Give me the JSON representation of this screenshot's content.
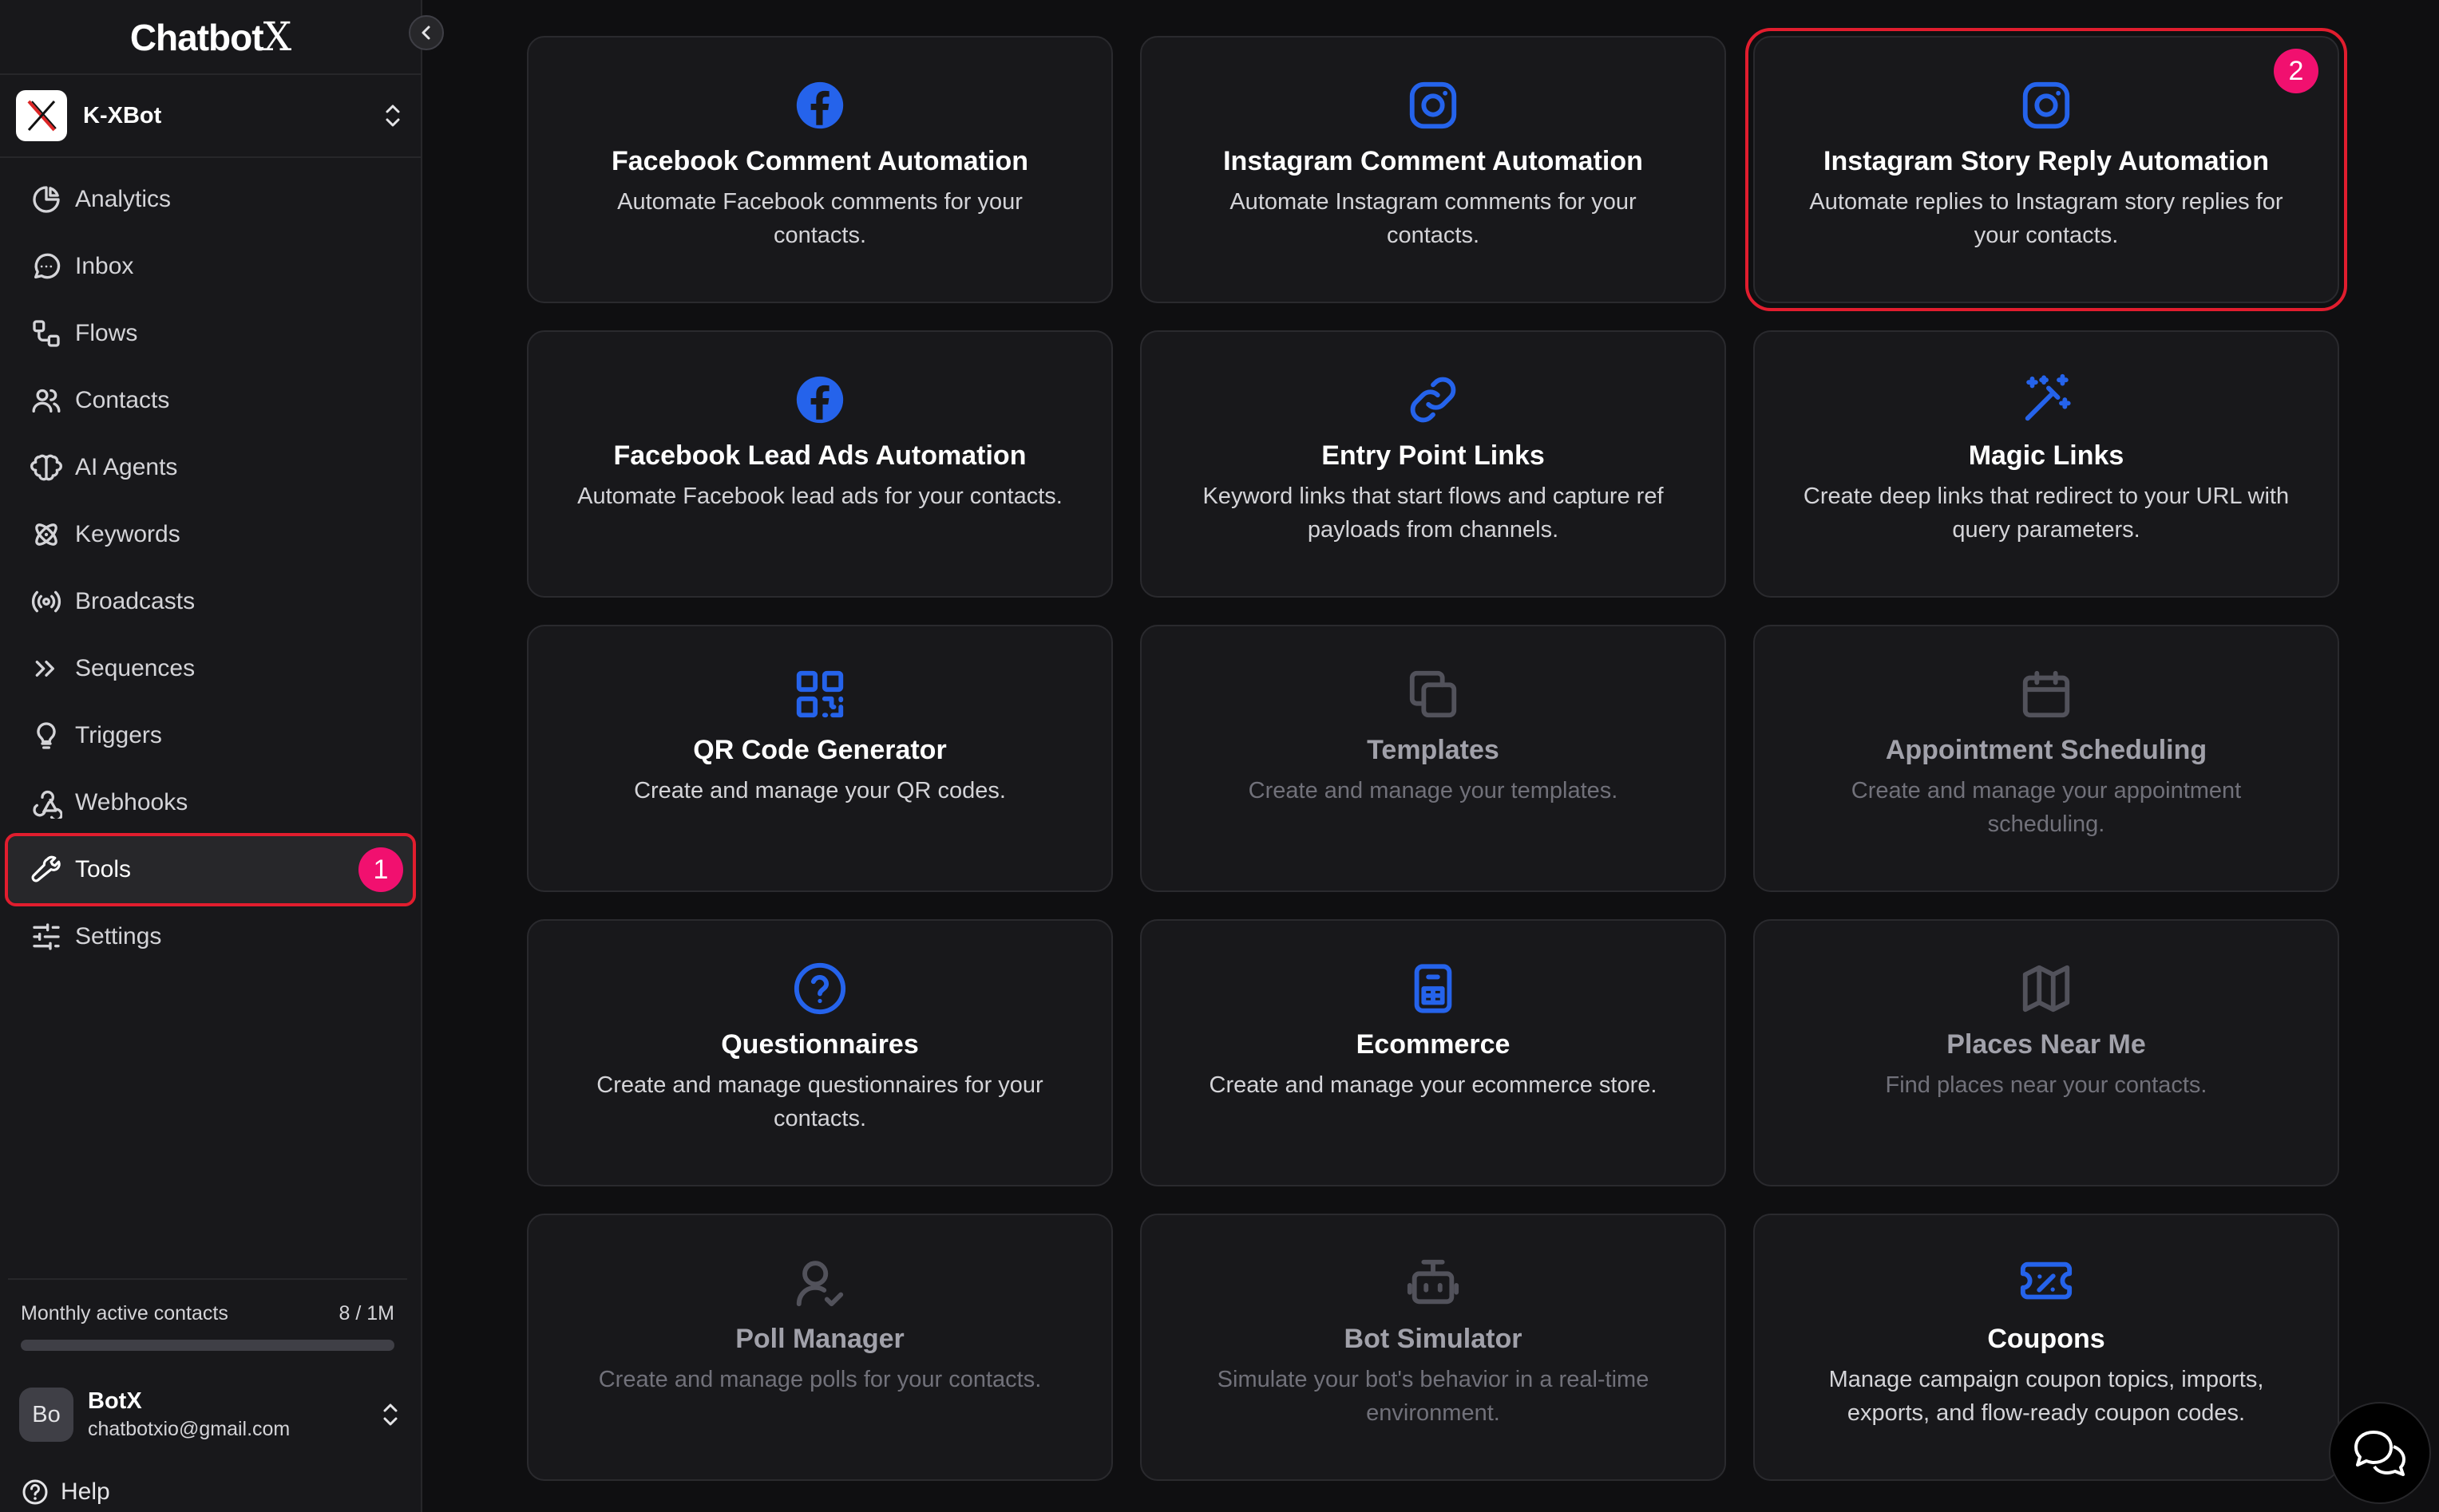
{
  "app": {
    "logo_main": "Chatbot",
    "logo_x": "X"
  },
  "bot": {
    "name": "K-XBot"
  },
  "sidebar": {
    "items": [
      {
        "label": "Analytics",
        "icon": "pie-chart-icon"
      },
      {
        "label": "Inbox",
        "icon": "message-circle-icon"
      },
      {
        "label": "Flows",
        "icon": "flow-icon"
      },
      {
        "label": "Contacts",
        "icon": "users-icon"
      },
      {
        "label": "AI Agents",
        "icon": "brain-icon"
      },
      {
        "label": "Keywords",
        "icon": "atom-icon"
      },
      {
        "label": "Broadcasts",
        "icon": "radio-icon"
      },
      {
        "label": "Sequences",
        "icon": "chevrons-right-icon"
      },
      {
        "label": "Triggers",
        "icon": "lightbulb-icon"
      },
      {
        "label": "Webhooks",
        "icon": "webhook-icon"
      },
      {
        "label": "Tools",
        "icon": "wrench-icon",
        "active": true,
        "badge": "1"
      },
      {
        "label": "Settings",
        "icon": "sliders-icon"
      }
    ]
  },
  "usage": {
    "label": "Monthly active contacts",
    "value": "8 / 1M",
    "fraction": 8e-06
  },
  "user": {
    "initials": "Bo",
    "name": "BotX",
    "email": "chatbotxio@gmail.com"
  },
  "help": {
    "label": "Help"
  },
  "cards": [
    {
      "title": "Facebook Comment Automation",
      "desc": "Automate Facebook comments for your contacts.",
      "icon": "facebook-icon",
      "enabled": true
    },
    {
      "title": "Instagram Comment Automation",
      "desc": "Automate Instagram comments for your contacts.",
      "icon": "instagram-icon",
      "enabled": true
    },
    {
      "title": "Instagram Story Reply Automation",
      "desc": "Automate replies to Instagram story replies for your contacts.",
      "icon": "instagram-icon",
      "enabled": true,
      "highlight": true,
      "badge": "2"
    },
    {
      "title": "Facebook Lead Ads Automation",
      "desc": "Automate Facebook lead ads for your contacts.",
      "icon": "facebook-icon",
      "enabled": true
    },
    {
      "title": "Entry Point Links",
      "desc": "Keyword links that start flows and capture ref payloads from channels.",
      "icon": "link-icon",
      "enabled": true
    },
    {
      "title": "Magic Links",
      "desc": "Create deep links that redirect to your URL with query parameters.",
      "icon": "magic-wand-icon",
      "enabled": true
    },
    {
      "title": "QR Code Generator",
      "desc": "Create and manage your QR codes.",
      "icon": "qr-code-icon",
      "enabled": true
    },
    {
      "title": "Templates",
      "desc": "Create and manage your templates.",
      "icon": "copy-icon",
      "enabled": false
    },
    {
      "title": "Appointment Scheduling",
      "desc": "Create and manage your appointment scheduling.",
      "icon": "calendar-icon",
      "enabled": false
    },
    {
      "title": "Questionnaires",
      "desc": "Create and manage questionnaires for your contacts.",
      "icon": "help-circle-icon",
      "enabled": true
    },
    {
      "title": "Ecommerce",
      "desc": "Create and manage your ecommerce store.",
      "icon": "store-icon",
      "enabled": true
    },
    {
      "title": "Places Near Me",
      "desc": "Find places near your contacts.",
      "icon": "map-icon",
      "enabled": false
    },
    {
      "title": "Poll Manager",
      "desc": "Create and manage polls for your contacts.",
      "icon": "user-check-icon",
      "enabled": false
    },
    {
      "title": "Bot Simulator",
      "desc": "Simulate your bot's behavior in a real-time environment.",
      "icon": "bot-icon",
      "enabled": false
    },
    {
      "title": "Coupons",
      "desc": "Manage campaign coupon topics, imports, exports, and flow-ready coupon codes.",
      "icon": "ticket-percent-icon",
      "enabled": true
    }
  ],
  "colors": {
    "accent": "#1d4ed8",
    "accent_icon": "#2563eb",
    "disabled_icon": "#52525b",
    "highlight": "#e11d2e",
    "badge": "#f1106f"
  }
}
